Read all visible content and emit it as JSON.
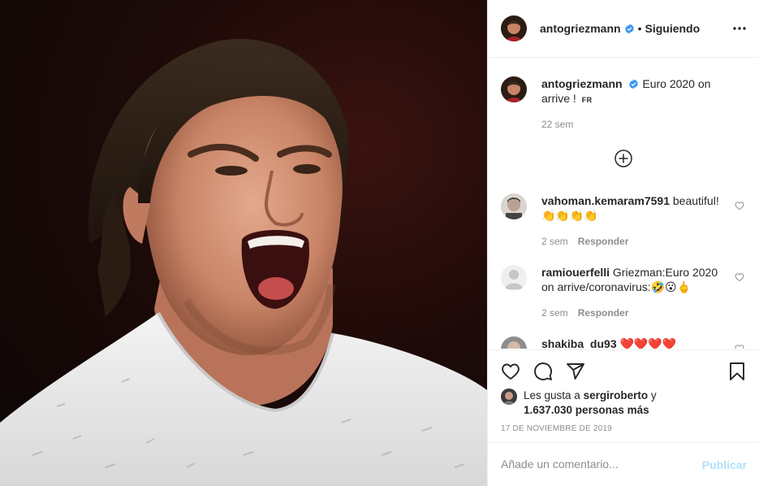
{
  "post": {
    "author": "antogriezmann",
    "separator": "•",
    "follow_status": "Siguiendo",
    "caption": {
      "username": "antogriezmann",
      "text": "Euro 2020 on arrive !",
      "lang_badge": "FR",
      "age": "22 sem"
    }
  },
  "comments": [
    {
      "username": "vahoman.kemaram7591",
      "text": "beautiful!👏👏👏👏",
      "age": "2 sem",
      "reply_label": "Responder"
    },
    {
      "username": "ramiouerfelli",
      "text": "Griezman:Euro 2020 on arrive/coronavirus:🤣😮🖕",
      "age": "2 sem",
      "reply_label": "Responder"
    },
    {
      "username": "shakiba_du93",
      "text": "❤️❤️❤️❤️"
    }
  ],
  "likes": {
    "prefix": "Les gusta a",
    "user": "sergiroberto",
    "joiner": "y",
    "count": "1.637.030 personas más"
  },
  "date": "17 DE NOVIEMBRE DE 2019",
  "comment_input": {
    "placeholder": "Añade un comentario...",
    "publish_label": "Publicar"
  },
  "icons": {
    "more": "more-dots-icon",
    "verified": "verified-badge-icon",
    "like": "heart-icon",
    "comment": "comment-bubble-icon",
    "share": "paper-plane-icon",
    "save": "bookmark-icon",
    "load_more": "plus-circle-icon"
  },
  "colors": {
    "verified": "#3897f0",
    "text": "#262626",
    "muted": "#8e8e8e",
    "publish_disabled": "#b2dffc",
    "divider": "#efefef"
  }
}
